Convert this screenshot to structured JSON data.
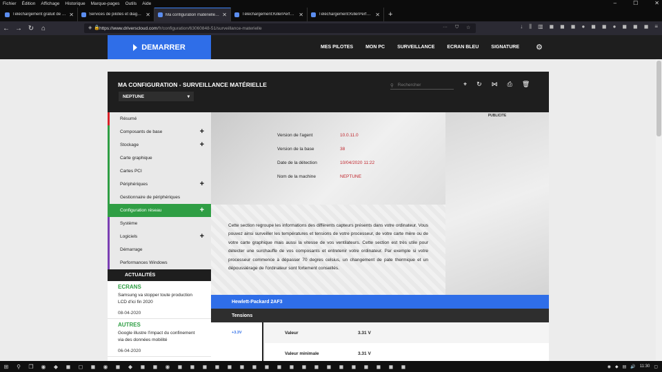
{
  "browser": {
    "menu": [
      "Fichier",
      "Édition",
      "Affichage",
      "Historique",
      "Marque-pages",
      "Outils",
      "Aide"
    ],
    "tabs": [
      {
        "title": "Téléchargement gratuit de drivers",
        "active": false
      },
      {
        "title": "Services de pilotes et diagnostic",
        "active": false
      },
      {
        "title": "Ma configuration matérielle et",
        "active": true
      },
      {
        "title": "Téléchargement:KillerPerforma",
        "active": false
      },
      {
        "title": "Téléchargement:KillerPerforma",
        "active": false
      }
    ],
    "new_tab_symbol": "+",
    "url_host": "https://www.driverscloud.com",
    "url_path": "/fr/configuration/63060848-51/surveillance-materielle"
  },
  "site": {
    "start_label": "DEMARRER",
    "nav": [
      "MES PILOTES",
      "MON PC",
      "SURVEILLANCE",
      "ECRAN BLEU",
      "SIGNATURE"
    ]
  },
  "panel": {
    "title": "MA CONFIGURATION - SURVEILLANCE MATÉRIELLE",
    "machine": "NEPTUNE",
    "search_placeholder": "Rechercher",
    "pub_label": "PUBLICITE"
  },
  "sidebar": {
    "items": [
      {
        "label": "Résumé",
        "plus": false,
        "color": "#d9232a"
      },
      {
        "label": "Composants de base",
        "plus": true,
        "color": "#2f9e44"
      },
      {
        "label": "Stockage",
        "plus": true,
        "color": "#2f9e44"
      },
      {
        "label": "Carte graphique",
        "plus": false,
        "color": "#2f9e44"
      },
      {
        "label": "Cartes PCI",
        "plus": false,
        "color": "#2f9e44"
      },
      {
        "label": "Périphériques",
        "plus": true,
        "color": "#2f9e44"
      },
      {
        "label": "Gestionnaire de périphériques",
        "plus": false,
        "color": "#2f9e44"
      },
      {
        "label": "Configuration réseau",
        "plus": true,
        "color": "#2f9e44",
        "active": true
      },
      {
        "label": "Système",
        "plus": false,
        "color": "#7b3fb3"
      },
      {
        "label": "Logiciels",
        "plus": true,
        "color": "#7b3fb3"
      },
      {
        "label": "Démarrage",
        "plus": false,
        "color": "#7b3fb3"
      },
      {
        "label": "Performances Windows",
        "plus": false,
        "color": "#7b3fb3"
      }
    ],
    "plus_symbol": "+"
  },
  "news": {
    "header": "ACTUALITÉS",
    "items": [
      {
        "category": "ECRANS",
        "text": "Samsung va stopper toute production LCD d'ici fin 2020",
        "date": "08-04-2020"
      },
      {
        "category": "AUTRES",
        "text": "Google illustre l'impact du confinement via des données mobilité",
        "date": "06-04-2020"
      }
    ]
  },
  "info": {
    "rows": [
      {
        "key": "Version de l'agent",
        "value": "10.0.11.0"
      },
      {
        "key": "Version de la base",
        "value": "38"
      },
      {
        "key": "Date de la détection",
        "value": "10/04/2020 11:22"
      },
      {
        "key": "Nom de la machine",
        "value": "NEPTUNE"
      }
    ]
  },
  "description": "Cette section regroupe les informations des différents capteurs présents dans votre ordinateur. Vous pouvez ainsi surveiller les températures et tensions de votre processeur, de votre carte mère ou de votre carte graphique mais aussi la vitesse de vos ventilateurs. Cette section est très utile pour détecter une surchauffe de vos composants et entretenir votre ordinateur. Par exemple si votre processeur commence à dépasser 70 degres celsius, un changement de pate thermique et un dépoussiérage de l'ordinateur sont fortement conseillés.",
  "hardware": {
    "device": "Hewlett-Packard 2AF3",
    "section": "Tensions",
    "sensor": "+3.3V",
    "values": [
      {
        "key": "Valeur",
        "value": "3.31 V"
      },
      {
        "key": "Valeur minimale",
        "value": "3.31 V"
      }
    ]
  },
  "taskbar": {
    "time": "11:30"
  }
}
